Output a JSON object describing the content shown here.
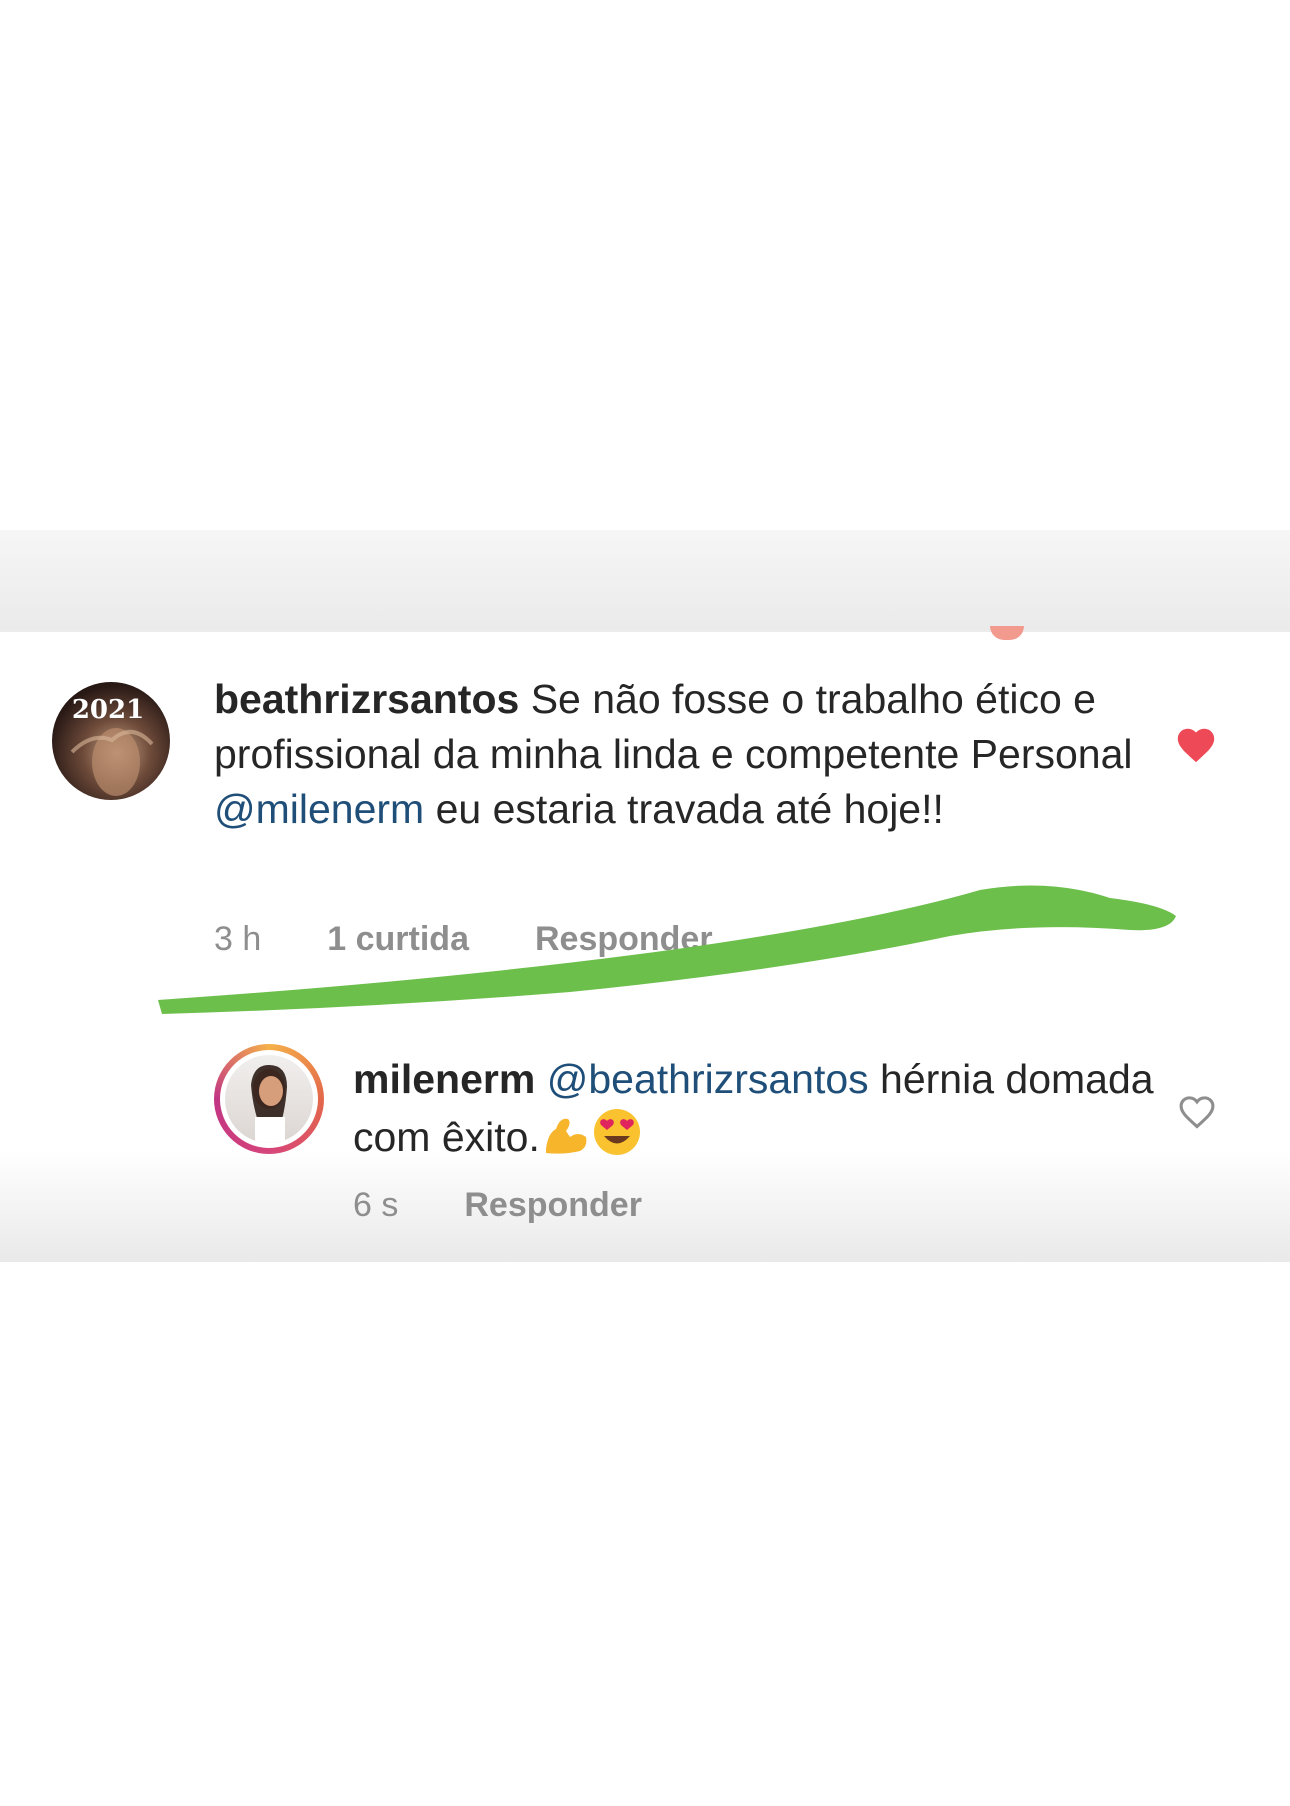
{
  "comments": [
    {
      "username": "beathrizrsantos",
      "text_before": " Se não fosse o trabalho ético e profissional da minha linda e competente Personal ",
      "mention": "@milenerm",
      "text_after": " eu estaria travada até hoje!!",
      "avatar_text": "2021",
      "time": "3 h",
      "likes": "1 curtida",
      "reply_label": "Responder",
      "liked": true,
      "like_color": "#ed4956"
    },
    {
      "username": "milenerm",
      "mention": "@beathrizrsantos",
      "text": " hérnia domada com êxito.",
      "emojis": [
        "flexed-biceps-emoji",
        "heart-eyes-emoji"
      ],
      "time": "6 s",
      "reply_label": "Responder",
      "liked": false
    }
  ],
  "colors": {
    "mention": "#1f4f78",
    "meta": "#8e8e8e",
    "scribble": "#6cbf4b",
    "story_ring_start": "#f5b04a",
    "story_ring_end": "#c13584"
  }
}
